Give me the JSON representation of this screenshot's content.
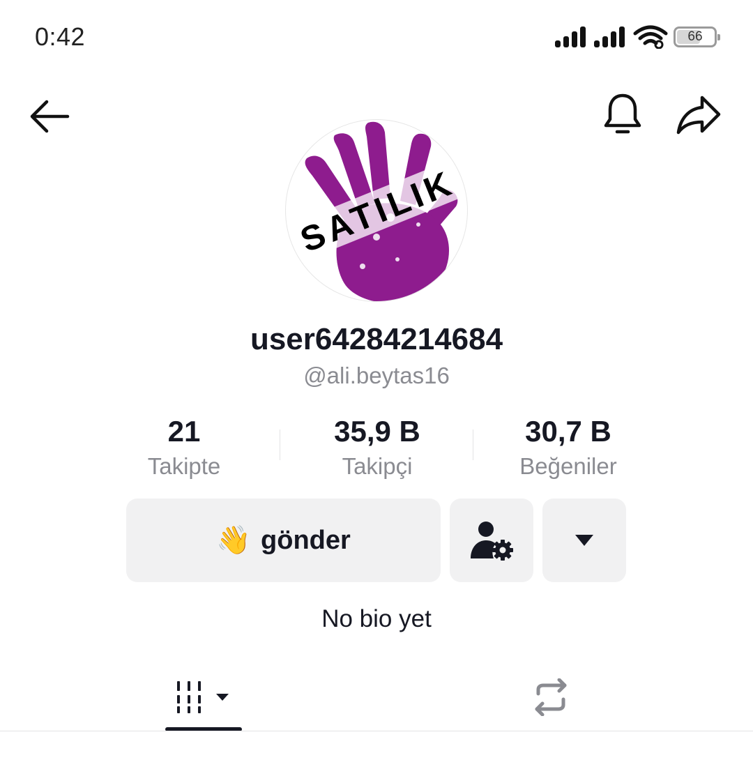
{
  "status_bar": {
    "time": "0:42",
    "battery": "66",
    "battery_level": 0.66,
    "icons": [
      "signal-icon",
      "signal-icon",
      "wifi-icon",
      "battery-icon"
    ]
  },
  "header": {
    "back_icon": "arrow-left-icon",
    "notification_icon": "bell-icon",
    "share_icon": "share-arrow-icon"
  },
  "profile": {
    "avatar_text": "SATILIK",
    "avatar_color": "#8e1c8e",
    "display_name": "user64284214684",
    "handle": "@ali.beytas16",
    "bio": "No bio yet"
  },
  "stats": {
    "following": {
      "value": "21",
      "label": "Takipte"
    },
    "followers": {
      "value": "35,9 B",
      "label": "Takipçi"
    },
    "likes": {
      "value": "30,7 B",
      "label": "Beğeniler"
    }
  },
  "actions": {
    "wave_emoji": "👋",
    "send_label": "gönder",
    "friend_icon": "user-settings-icon",
    "more_icon": "caret-down-icon"
  },
  "tabs": {
    "videos_icon": "grid-videos-icon",
    "reposts_icon": "repost-icon",
    "active": "videos"
  },
  "colors": {
    "text_primary": "#161823",
    "text_secondary": "#8a8b91",
    "button_bg": "#f1f1f2"
  }
}
